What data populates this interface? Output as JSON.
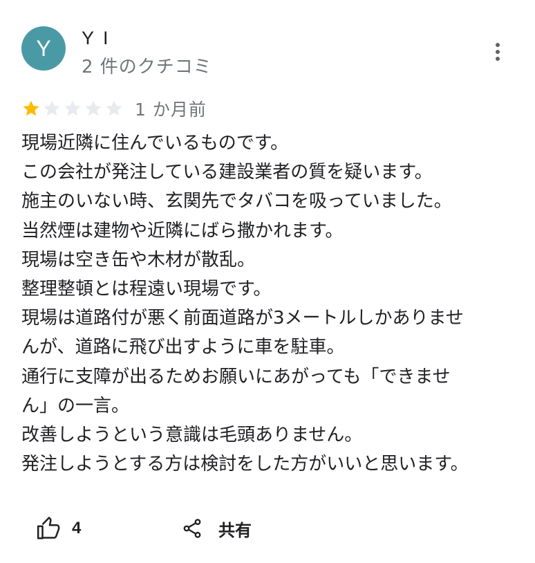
{
  "reviewer": {
    "avatar_initial": "Y",
    "name": "Y I",
    "review_count": "2 件のクチコミ"
  },
  "more_icon": "more-vertical-icon",
  "rating": {
    "stars": 1,
    "max_stars": 5,
    "filled_color": "#fbbc04",
    "empty_color": "#e8eaed"
  },
  "date": "1 か月前",
  "review_lines": [
    "現場近隣に住んでいるものです。",
    "この会社が発注している建設業者の質を疑います。",
    "施主のいない時、玄関先でタバコを吸っていました。",
    "当然煙は建物や近隣にばら撒かれます。",
    "現場は空き缶や木材が散乱。",
    "整理整頓とは程遠い現場です。",
    "現場は道路付が悪く前面道路が3メートルしかありませ",
    "んが、道路に飛び出すように車を駐車。",
    "通行に支障が出るためお願いにあがっても「できませ",
    "ん」の一言。",
    "改善しようという意識は毛頭ありません。",
    "発注しようとする方は検討をした方がいいと思います。"
  ],
  "actions": {
    "like_icon": "thumbs-up-icon",
    "like_count": "4",
    "share_icon": "share-icon",
    "share_label": "共有"
  },
  "colors": {
    "avatar_bg": "#4a9aa5",
    "secondary_text": "#70757a",
    "primary_text": "#202124"
  }
}
